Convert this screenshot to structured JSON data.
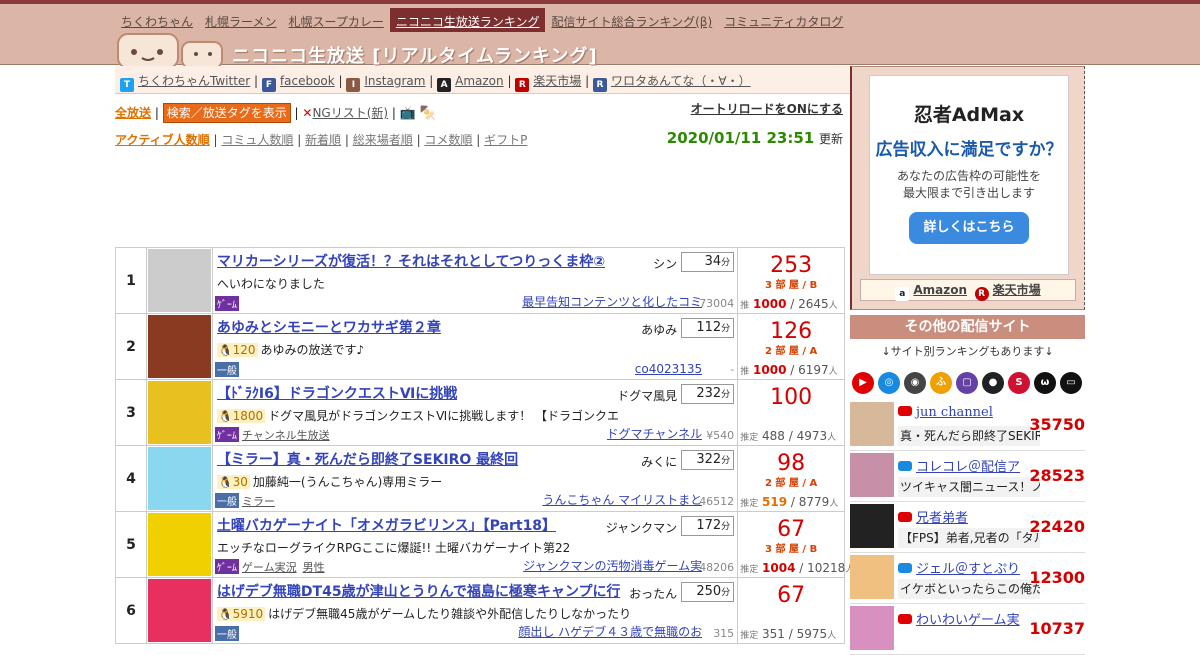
{
  "nav": [
    "ちくわちゃん",
    "札幌ラーメン",
    "札幌スープカレー",
    "ニコニコ生放送ランキング",
    "配信サイト総合ランキング(β)",
    "コミュニティカタログ"
  ],
  "active_nav": 3,
  "site_title": "ニコニコ生放送 [リアルタイムランキング]",
  "social": [
    {
      "icon": "twitter-icon",
      "label": "ちくわちゃんTwitter",
      "color": "#1da1f2"
    },
    {
      "icon": "facebook-icon",
      "label": "facebook",
      "color": "#3b5998"
    },
    {
      "icon": "instagram-icon",
      "label": "Instagram",
      "color": "#8a5a44"
    },
    {
      "icon": "amazon-icon",
      "label": "Amazon",
      "color": "#222"
    },
    {
      "icon": "rakuten-icon",
      "label": "楽天市場",
      "color": "#bf0000"
    },
    {
      "icon": "rss-icon",
      "label": "ワロタあんてな（・∀・）",
      "color": "#3b5998"
    }
  ],
  "controls": {
    "all": "全放送",
    "tags_button": "検索／放送タグを表示",
    "ng": "NGリスト(新)",
    "autoreload": "オートリロードをONにする"
  },
  "sort": {
    "active": "アクティブ人数順",
    "others": [
      "コミュ人数順",
      "新着順",
      "総来場者順",
      "コメ数順",
      "ギフトP"
    ]
  },
  "datetime": "2020/01/11 23:51",
  "updated_label": "更新",
  "units": {
    "minutes": "分",
    "people": "人",
    "floor_suffix": "部 屋"
  },
  "rows": [
    {
      "rank": "1",
      "title": "マリカーシリーズが復活！？それはそれとしてつりっくま枠②",
      "owner": "シン",
      "minutes": "34",
      "level": "",
      "desc": "へいわになりました",
      "category": "ｹﾞｰﾑ",
      "cat_color": "#7030a0",
      "tags": [],
      "community": "最早告知コンテンツと化したコミ",
      "cid": "73004",
      "count": "253",
      "room": "3",
      "grade": "B",
      "stat_label": "推",
      "active": "1000",
      "total": "2645",
      "thumb": "#ccc"
    },
    {
      "rank": "2",
      "title": "あゆみとシモニーとワカサギ第２章",
      "owner": "あゆみ",
      "minutes": "112",
      "level": "120",
      "desc": "あゆみの放送です♪",
      "category": "一般",
      "cat_color": "#4a6ea8",
      "tags": [],
      "community": "co4023135",
      "cid": "-",
      "count": "126",
      "room": "2",
      "grade": "A",
      "stat_label": "推",
      "active": "1000",
      "total": "6197",
      "thumb": "#8a3a20"
    },
    {
      "rank": "3",
      "title": "【ﾄﾞﾗｸI6】ドラゴンクエストⅥに挑戦",
      "owner": "ドグマ風見",
      "minutes": "232",
      "level": "1800",
      "desc": "ドグマ風見がドラゴンクエストⅥに挑戦します！ 【ドラゴンクエ",
      "category": "ｹﾞｰﾑ",
      "cat_color": "#7030a0",
      "tags": [
        "チャンネル生放送"
      ],
      "community": "ドグマチャンネル",
      "cid": "¥540",
      "count": "100",
      "room": "",
      "grade": "",
      "stat_label": "推定",
      "active": "488",
      "total": "4973",
      "thumb": "#e8c020"
    },
    {
      "rank": "4",
      "title": "【ミラー】真・死んだら即終了SEKIRO 最終回",
      "owner": "みくに",
      "minutes": "322",
      "level": "30",
      "desc": "加藤純一(うんこちゃん)専用ミラー",
      "category": "一般",
      "cat_color": "#4a6ea8",
      "tags": [
        "ミラー"
      ],
      "community": "うんこちゃん マイリストまと",
      "cid": "46512",
      "count": "98",
      "room": "2",
      "grade": "A",
      "stat_label": "推定",
      "active": "519",
      "total": "8779",
      "thumb": "#8ad8f0"
    },
    {
      "rank": "5",
      "title": "土曜バカゲーナイト「オメガラビリンス」【Part18】",
      "owner": "ジャンクマン",
      "minutes": "172",
      "level": "",
      "desc": "エッチなローグライクRPGここに爆誕!! 土曜バカゲーナイト第22",
      "category": "ｹﾞｰﾑ",
      "cat_color": "#7030a0",
      "tags": [
        "ゲーム実況",
        "男性"
      ],
      "community": "ジャンクマンの汚物消毒ゲーム実",
      "cid": "48206",
      "count": "67",
      "room": "3",
      "grade": "B",
      "stat_label": "推定",
      "active": "1004",
      "total": "10218",
      "thumb": "#f0d000"
    },
    {
      "rank": "6",
      "title": "はげデブ無職DT45歳が津山とうりんで福島に極寒キャンプに行",
      "owner": "おったん",
      "minutes": "250",
      "level": "5910",
      "desc": "はげデブ無職45歳がゲームしたり雑談や外配信したりしなかったり",
      "category": "一般",
      "cat_color": "#4a6ea8",
      "tags": [],
      "community": "顔出し ハゲデブ４３歳で無職のお",
      "cid": "315",
      "count": "67",
      "room": "",
      "grade": "",
      "stat_label": "推定",
      "active": "351",
      "total": "5975",
      "thumb": "#e83060"
    }
  ],
  "ad": {
    "logo": "忍者AdMax",
    "headline": "広告収入に満足ですか？",
    "sub1": "あなたの広告枠の可能性を",
    "sub2": "最大限まで引き出します",
    "button": "詳しくはこちら",
    "links": [
      "Amazon",
      "楽天市場"
    ]
  },
  "sidebar": {
    "heading": "その他の配信サイト",
    "note": "↓サイト別ランキングもあります↓",
    "site_icons": [
      {
        "name": "youtube-icon",
        "color": "#e00000",
        "glyph": "▶"
      },
      {
        "name": "twitcasting-icon",
        "color": "#1a8ae0",
        "glyph": "◎"
      },
      {
        "name": "openrec-icon",
        "color": "#444",
        "glyph": "◉"
      },
      {
        "name": "fresh-icon",
        "color": "#f0a000",
        "glyph": "ふ"
      },
      {
        "name": "twitch-icon",
        "color": "#6441a5",
        "glyph": "▢"
      },
      {
        "name": "mildom-icon",
        "color": "#222",
        "glyph": "●"
      },
      {
        "name": "showroom-icon",
        "color": "#d01030",
        "glyph": "S"
      },
      {
        "name": "cat-icon",
        "color": "#111",
        "glyph": "ω"
      },
      {
        "name": "tv-icon",
        "color": "#111",
        "glyph": "▭"
      }
    ],
    "streams": [
      {
        "name": "jun channel",
        "title": "真・死んだら即終了SEKIRO",
        "viewers": "35750",
        "icon_color": "#e00000",
        "avatar": "#d8b89a"
      },
      {
        "name": "コレコレ＠配信ア",
        "title": "ツイキャス闇ニュース！ノ",
        "viewers": "28523",
        "icon_color": "#1a8ae0",
        "avatar": "#c890a8"
      },
      {
        "name": "兄者弟者",
        "title": "【FPS】弟者,兄者の「タル",
        "viewers": "22420",
        "icon_color": "#e00000",
        "avatar": "#222"
      },
      {
        "name": "ジェル＠すとぷり",
        "title": "イケボといったらこの俺だ",
        "viewers": "12300",
        "icon_color": "#1a8ae0",
        "avatar": "#f0c080"
      },
      {
        "name": "わいわいゲーム実",
        "title": "",
        "viewers": "10737",
        "icon_color": "#e00000",
        "avatar": "#d890c0"
      }
    ]
  }
}
